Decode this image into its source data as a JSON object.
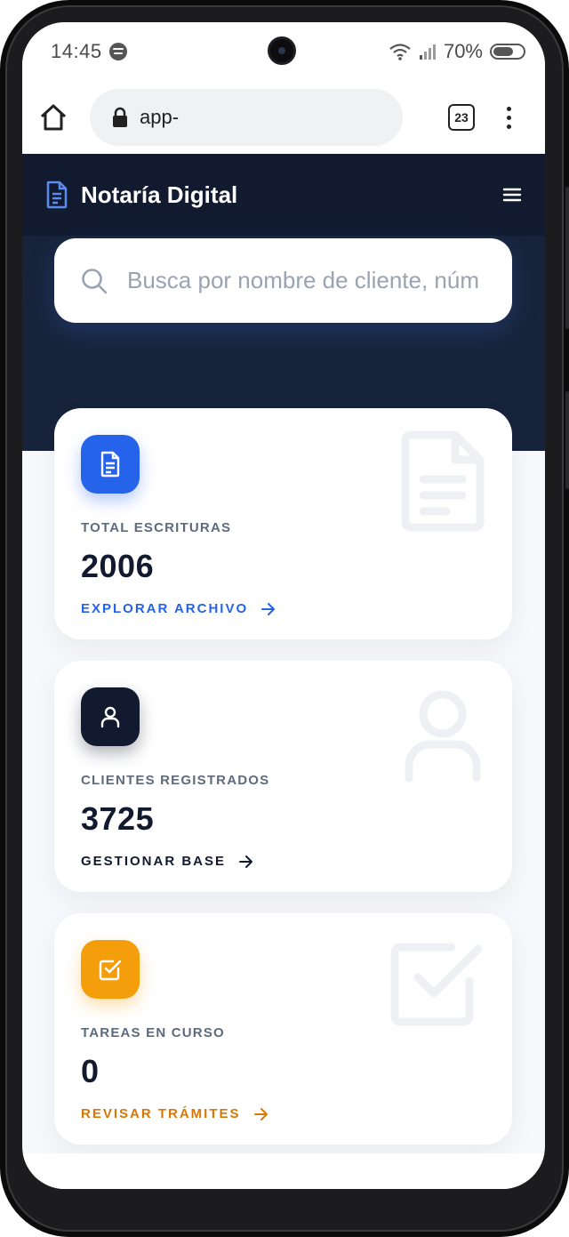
{
  "status_bar": {
    "time": "14:45",
    "battery": "70%",
    "battery_fraction": 0.7
  },
  "browser": {
    "url": "app-",
    "tab_count": "23"
  },
  "app": {
    "title": "Notaría Digital",
    "search_placeholder": "Busca por nombre de cliente, núm"
  },
  "cards": [
    {
      "label": "TOTAL ESCRITURAS",
      "value": "2006",
      "link": "EXPLORAR ARCHIVO",
      "accent": "#2563eb",
      "link_color": "#2563eb",
      "icon": "document-icon"
    },
    {
      "label": "CLIENTES REGISTRADOS",
      "value": "3725",
      "link": "GESTIONAR BASE",
      "accent": "#111a2e",
      "link_color": "#111a2e",
      "icon": "user-icon"
    },
    {
      "label": "TAREAS EN CURSO",
      "value": "0",
      "link": "REVISAR TRÁMITES",
      "accent": "#f59e0b",
      "link_color": "#d97706",
      "icon": "check-square-icon"
    }
  ],
  "colors": {
    "header_bg": "#111a2e",
    "hero_bg": "#17233a",
    "page_bg": "#f6f8fb"
  }
}
